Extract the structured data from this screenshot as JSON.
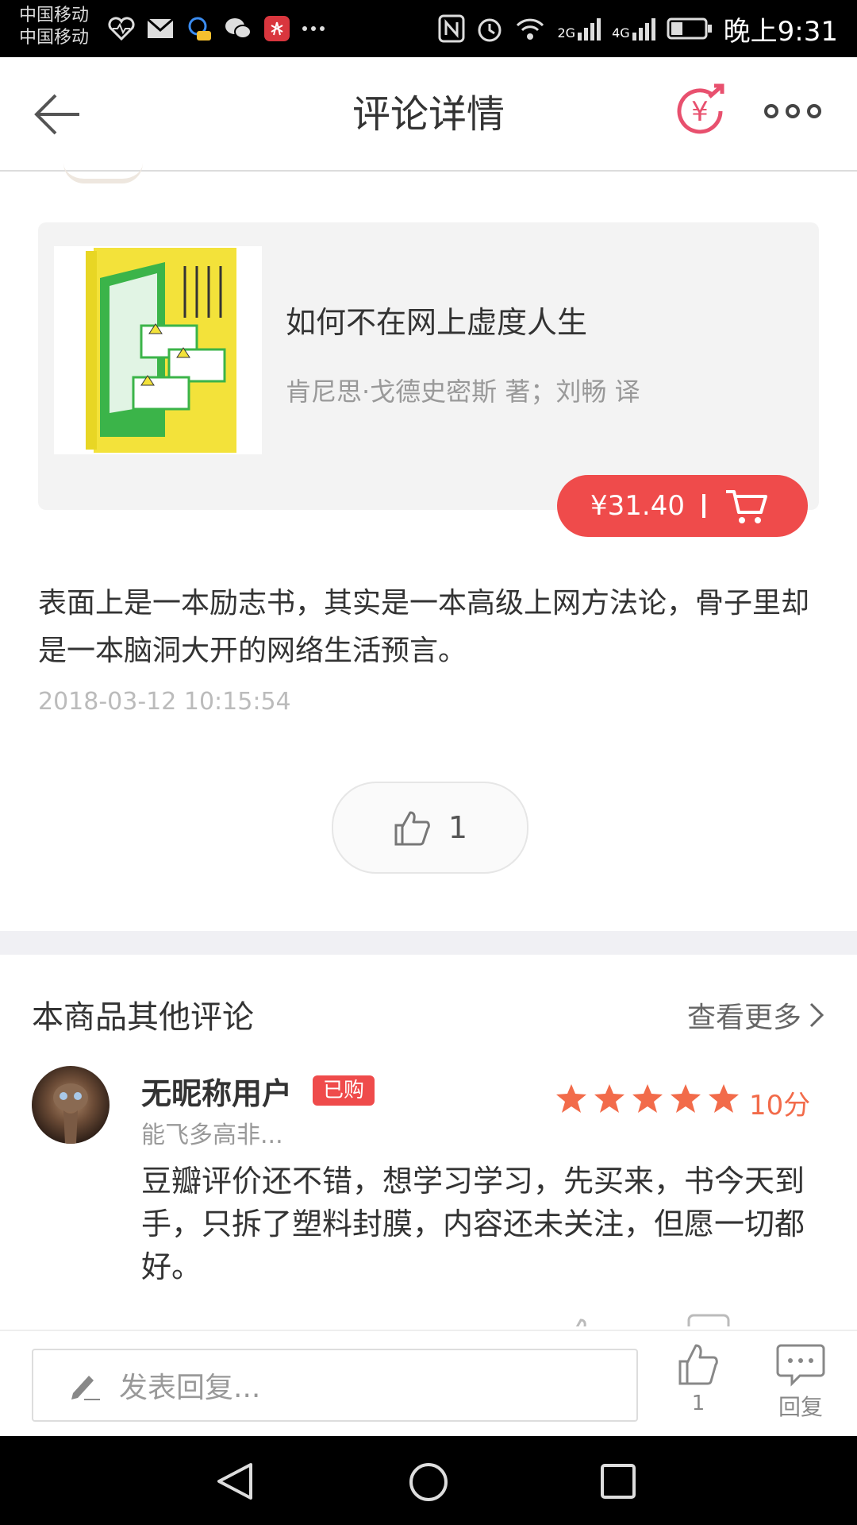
{
  "status_bar": {
    "carrier_1": "中国移动",
    "carrier_2": "中国移动",
    "network_2g": "2G",
    "network_4g": "4G",
    "time": "晚上9:31"
  },
  "header": {
    "title": "评论详情",
    "yen_icon_text": "¥"
  },
  "product": {
    "title": "如何不在网上虚度人生",
    "author": "肯尼思·戈德史密斯 著；刘畅 译",
    "price": "¥31.40"
  },
  "review": {
    "text": "表面上是一本励志书，其实是一本高级上网方法论，骨子里却是一本脑洞大开的网络生活预言。",
    "date": "2018-03-12 10:15:54",
    "like_count": "1"
  },
  "other_reviews": {
    "section_title": "本商品其他评论",
    "see_more": "查看更多",
    "items": [
      {
        "username": "无昵称用户",
        "badge": "已购",
        "subname": "能飞多高非...",
        "rating_stars": 5,
        "score": "10分",
        "text": "豆瓣评价还不错，想学习学习，先买来，书今天到手，只拆了塑料封膜，内容还未关注，但愿一切都好。"
      }
    ]
  },
  "bottom_bar": {
    "reply_placeholder": "发表回复...",
    "like_count": "1",
    "reply_label": "回复"
  },
  "colors": {
    "accent_red": "#ef4b4b",
    "star_orange": "#f26b4a",
    "yen_pink": "#e8506e"
  }
}
